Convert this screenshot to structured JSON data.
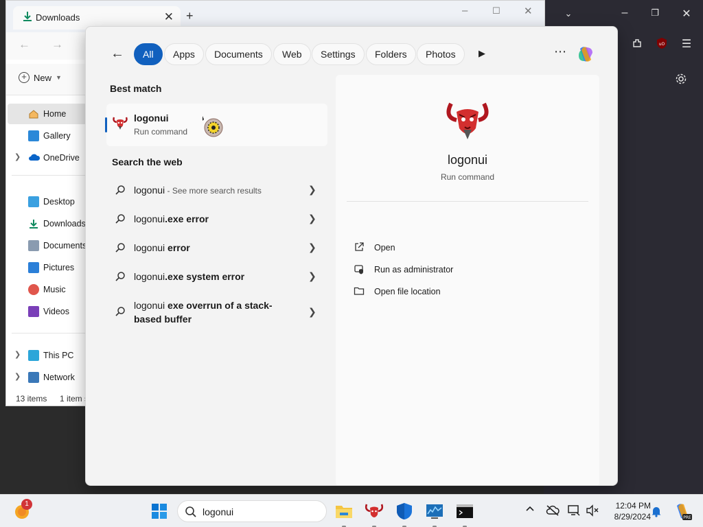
{
  "explorer": {
    "tab_title": "Downloads",
    "new_label": "New",
    "sidebar": {
      "home": "Home",
      "gallery": "Gallery",
      "onedrive": "OneDrive",
      "desktop": "Desktop",
      "downloads": "Downloads",
      "documents": "Documents",
      "pictures": "Pictures",
      "music": "Music",
      "videos": "Videos",
      "this_pc": "This PC",
      "network": "Network"
    },
    "status": {
      "items": "13 items",
      "selected": "1 item s"
    }
  },
  "search_panel": {
    "filters": [
      "All",
      "Apps",
      "Documents",
      "Web",
      "Settings",
      "Folders",
      "Photos"
    ],
    "active_filter": "All",
    "best_match_heading": "Best match",
    "best_match": {
      "title": "logonui",
      "subtitle": "Run command"
    },
    "web_heading": "Search the web",
    "web_results": [
      {
        "bold": "logonui",
        "rest": "",
        "hint": " - See more search results"
      },
      {
        "bold": "logonui",
        "rest": ".exe error",
        "hint": ""
      },
      {
        "bold": "logonui",
        "rest": " error",
        "hint": ""
      },
      {
        "bold": "logonui",
        "rest": ".exe system error",
        "hint": ""
      },
      {
        "bold": "logonui",
        "rest": " exe overrun of a stack-based buffer",
        "hint": ""
      }
    ],
    "detail": {
      "title": "logonui",
      "subtitle": "Run command",
      "actions": {
        "open": "Open",
        "run_admin": "Run as administrator",
        "open_location": "Open file location"
      }
    }
  },
  "taskbar": {
    "search_query": "logonui",
    "weather_badge": "1",
    "time": "12:04 PM",
    "date": "8/29/2024"
  },
  "colors": {
    "accent": "#1160be",
    "panel_bg": "#f3f3f3",
    "dark_app_bg": "#2b2a33"
  }
}
